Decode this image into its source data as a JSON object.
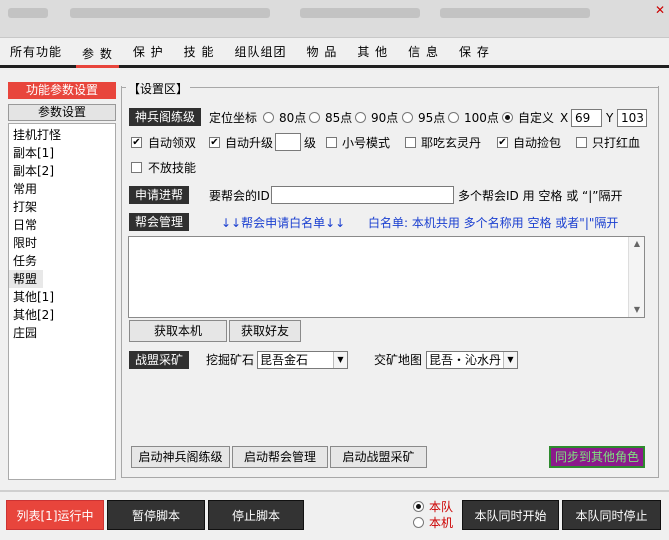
{
  "window": {
    "close_glyph": "✕"
  },
  "tabs": [
    {
      "label": "所有功能"
    },
    {
      "label": "参 数"
    },
    {
      "label": "保 护"
    },
    {
      "label": "技 能"
    },
    {
      "label": "组队组团"
    },
    {
      "label": "物 品"
    },
    {
      "label": "其 他"
    },
    {
      "label": "信 息"
    },
    {
      "label": "保 存"
    }
  ],
  "sidebar": {
    "title": "功能参数设置",
    "button": "参数设置",
    "items": [
      "挂机打怪",
      "副本[1]",
      "副本[2]",
      "常用",
      "打架",
      "日常",
      "限时",
      "任务",
      "帮盟",
      "其他[1]",
      "其他[2]",
      "庄园"
    ],
    "selected": "帮盟"
  },
  "panel": {
    "legend": "【设置区】",
    "row1": {
      "label": "神兵阁练级",
      "coord_label": "定位坐标",
      "options": [
        "80点",
        "85点",
        "90点",
        "95点",
        "100点",
        "自定义"
      ],
      "selected": "自定义",
      "x_label": "X",
      "x_value": "69",
      "y_label": "Y",
      "y_value": "103"
    },
    "row2": {
      "auto_double": "自动领双",
      "auto_upgrade": "自动升级",
      "level_unit": "级",
      "small_mode": "小号模式",
      "eat_pill": "耶吃玄灵丹",
      "auto_pick": "自动捡包",
      "red_only": "只打红血",
      "no_skill": "不放技能"
    },
    "apply": {
      "label": "申请进帮",
      "prompt": "要帮会的ID",
      "hint": "多个帮会ID 用 空格 或 “|”隔开"
    },
    "guild": {
      "label": "帮会管理",
      "arrows": "↓↓帮会申请白名单↓↓",
      "whitelist_hint": "白名单: 本机共用 多个名称用 空格 或者\"|\"隔开",
      "fetch_local": "获取本机",
      "fetch_friends": "获取好友"
    },
    "mining": {
      "label": "战盟采矿",
      "dig_label": "挖掘矿石",
      "dig_value": "昆吾金石",
      "deliver_label": "交矿地图",
      "deliver_value": "昆吾・沁水丹"
    },
    "actions": {
      "start_train": "启动神兵阁练级",
      "start_guild": "启动帮会管理",
      "start_mining": "启动战盟采矿",
      "sync": "同步到其他角色"
    }
  },
  "bottom": {
    "run_list": "列表[1]运行中",
    "pause": "暂停脚本",
    "stop": "停止脚本",
    "team_radio": "本队",
    "local_radio": "本机",
    "team_start": "本队同时开始",
    "team_stop": "本队同时停止"
  }
}
